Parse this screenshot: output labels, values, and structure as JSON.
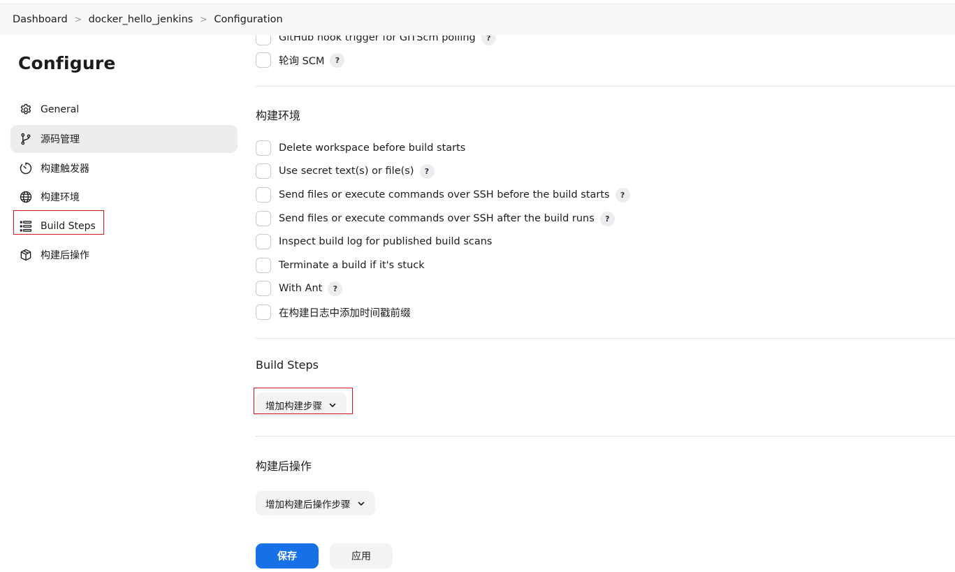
{
  "breadcrumb": {
    "items": [
      "Dashboard",
      "docker_hello_jenkins",
      "Configuration"
    ],
    "separator": ">"
  },
  "sidebar": {
    "title": "Configure",
    "items": [
      {
        "label": "General",
        "icon": "gear-icon"
      },
      {
        "label": "源码管理",
        "icon": "branch-icon",
        "active": true
      },
      {
        "label": "构建触发器",
        "icon": "timer-icon"
      },
      {
        "label": "构建环境",
        "icon": "globe-icon"
      },
      {
        "label": "Build Steps",
        "icon": "list-icon",
        "highlighted": true
      },
      {
        "label": "构建后操作",
        "icon": "package-icon"
      }
    ]
  },
  "triggers": {
    "partial_item": "GitHub hook trigger for GITScm polling",
    "poll_scm": "轮询 SCM"
  },
  "build_env": {
    "heading": "构建环境",
    "options": [
      {
        "label": "Delete workspace before build starts",
        "help": false
      },
      {
        "label": "Use secret text(s) or file(s)",
        "help": true
      },
      {
        "label": "Send files or execute commands over SSH before the build starts",
        "help": true
      },
      {
        "label": "Send files or execute commands over SSH after the build runs",
        "help": true
      },
      {
        "label": "Inspect build log for published build scans",
        "help": false
      },
      {
        "label": "Terminate a build if it's stuck",
        "help": false
      },
      {
        "label": "With Ant",
        "help": true
      },
      {
        "label": "在构建日志中添加时间戳前缀",
        "help": false
      }
    ]
  },
  "build_steps": {
    "heading": "Build Steps",
    "add_button": "增加构建步骤"
  },
  "post_build": {
    "heading": "构建后操作",
    "add_button": "增加构建后操作步骤"
  },
  "actions": {
    "save": "保存",
    "apply": "应用"
  },
  "help_glyph": "?",
  "colors": {
    "primary": "#1670e6",
    "highlight": "#d9131e",
    "active_nav": "#ededf0"
  }
}
